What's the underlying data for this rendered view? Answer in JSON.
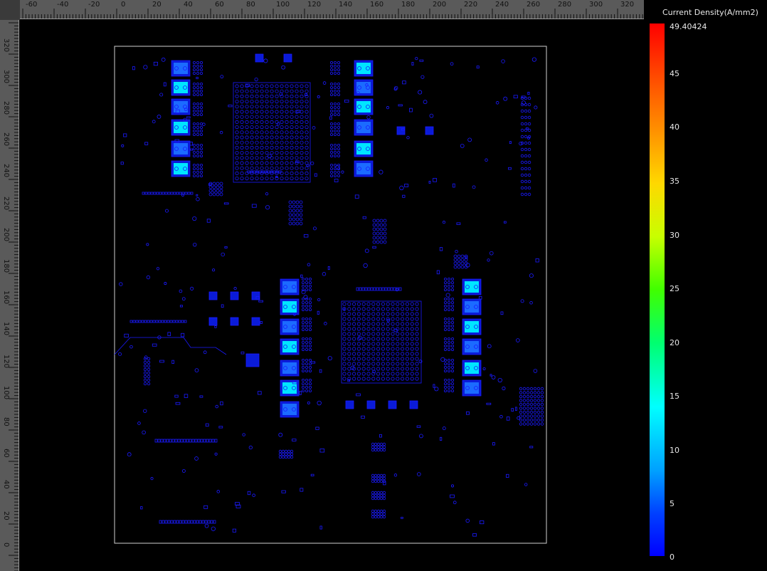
{
  "ruler_top": {
    "labels": [
      "-60",
      "-40",
      "-20",
      "0",
      "20",
      "40",
      "60",
      "80",
      "100",
      "120",
      "140",
      "160",
      "180",
      "200",
      "220",
      "240",
      "260",
      "280",
      "300",
      "320"
    ]
  },
  "ruler_left": {
    "labels": [
      "320",
      "300",
      "280",
      "260",
      "240",
      "220",
      "200",
      "180",
      "160",
      "140",
      "120",
      "100",
      "80",
      "60",
      "40",
      "20",
      "0"
    ]
  },
  "colorbar": {
    "title": "Current Density(A/mm2)",
    "max_label": "49.40424",
    "tick_labels": [
      "45",
      "40",
      "35",
      "30",
      "25",
      "20",
      "15",
      "10",
      "5",
      "0"
    ],
    "max_value": 49.40424,
    "min_value": 0
  },
  "colors": {
    "background": "#000000",
    "trace": "#1a1aff",
    "board_outline": "#cfcfcf",
    "hot_cyan": "#00e5ff",
    "hot_green": "#4dff4d"
  }
}
